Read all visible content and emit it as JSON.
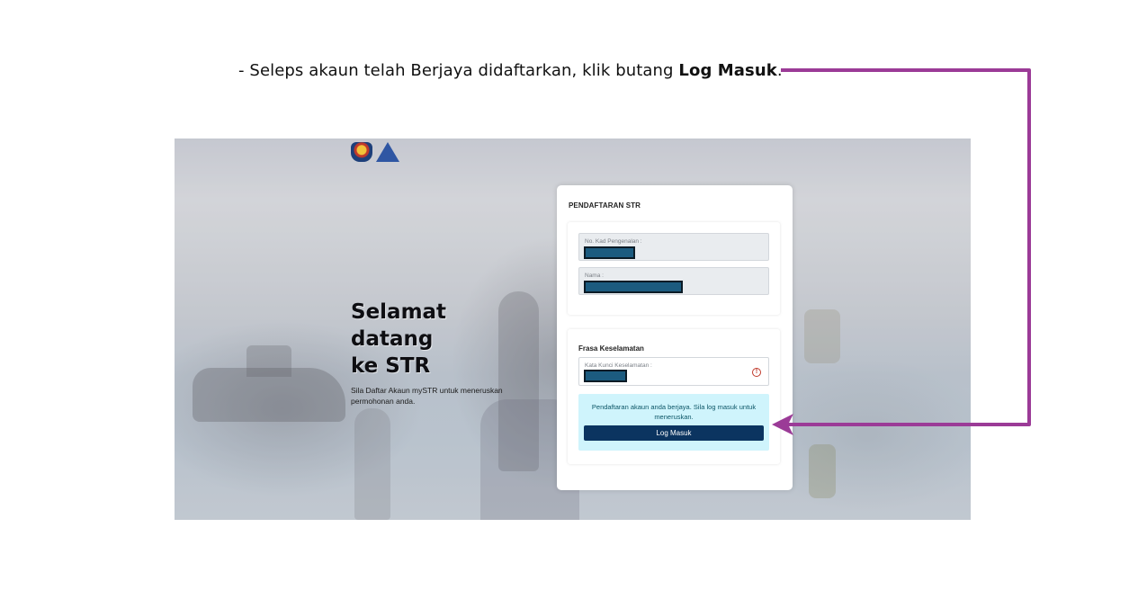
{
  "caption": {
    "prefix": "- Seleps akaun telah Berjaya didaftarkan, klik butang ",
    "bold": "Log Masuk",
    "suffix": "."
  },
  "hero": {
    "title_line1": "Selamat datang",
    "title_line2": "ke STR",
    "subtitle": "Sila Daftar Akaun mySTR untuk meneruskan permohonan anda."
  },
  "card": {
    "title": "PENDAFTARAN STR",
    "fields": {
      "ic_label": "No. Kad Pengenalan :",
      "name_label": "Nama :"
    },
    "security": {
      "title": "Frasa Keselamatan",
      "keyword_label": "Kata Kunci Keselamatan :",
      "warning_icon": "!"
    },
    "alert": {
      "message": "Pendaftaran akaun anda berjaya. Sila log masuk untuk meneruskan.",
      "button_label": "Log Masuk"
    }
  },
  "colors": {
    "arrow": "#9b3b97",
    "button": "#0b3460",
    "alert_bg": "#cff4fc"
  }
}
